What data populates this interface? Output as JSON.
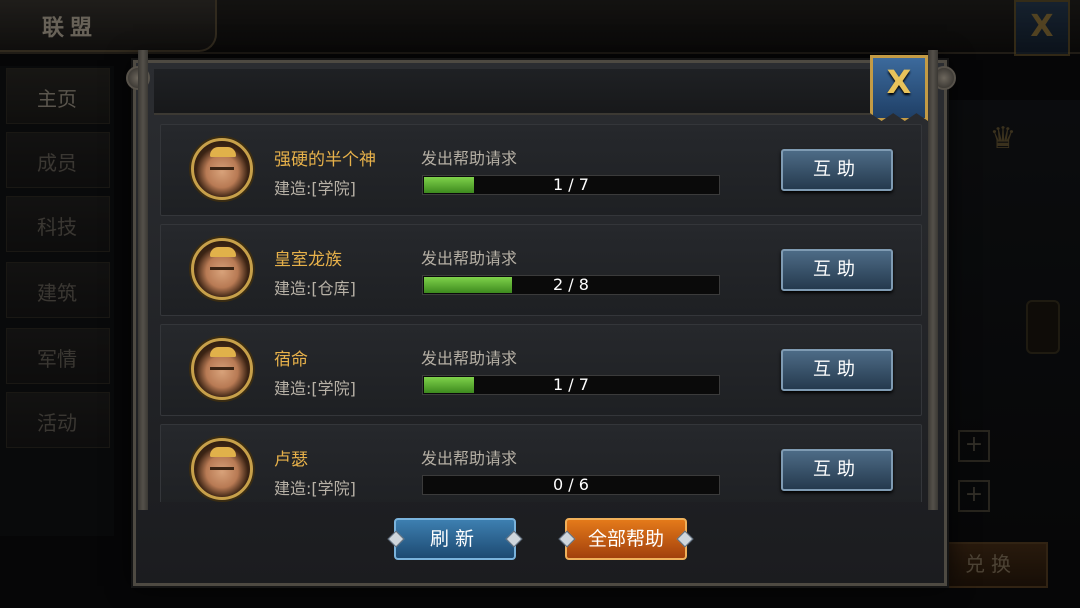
{
  "background": {
    "title": "联盟",
    "close_icon": "X",
    "tabs": [
      "主页",
      "成员",
      "科技",
      "建筑",
      "军情",
      "活动"
    ],
    "exchange_label": "兑换"
  },
  "modal": {
    "close_icon": "X",
    "rows": [
      {
        "name": "强硬的半个神",
        "building": "建造:[学院]",
        "request": "发出帮助请求",
        "progress_text": "1 / 7",
        "progress": 0.143,
        "button": "互助"
      },
      {
        "name": "皇室龙族",
        "building": "建造:[仓库]",
        "request": "发出帮助请求",
        "progress_text": "2 / 8",
        "progress": 0.25,
        "button": "互助"
      },
      {
        "name": "宿命",
        "building": "建造:[学院]",
        "request": "发出帮助请求",
        "progress_text": "1 / 7",
        "progress": 0.143,
        "button": "互助"
      },
      {
        "name": "卢瑟",
        "building": "建造:[学院]",
        "request": "发出帮助请求",
        "progress_text": "0 / 6",
        "progress": 0,
        "button": "互助"
      }
    ],
    "refresh_label": "刷新",
    "help_all_label": "全部帮助"
  },
  "colors": {
    "name": "#e7b14a",
    "progress_fill": "#5fb236",
    "help_button": "#3a5670",
    "help_all_button": "#c95f14"
  }
}
